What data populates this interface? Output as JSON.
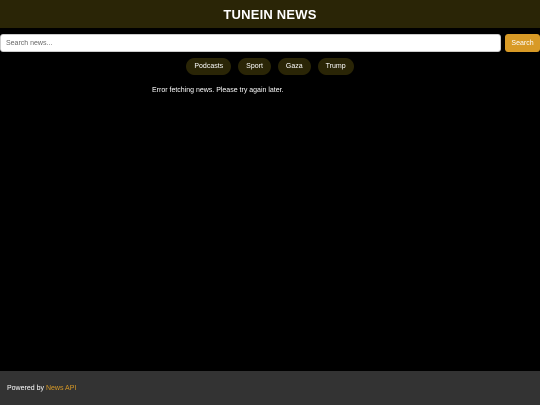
{
  "header": {
    "title": "TUNEIN NEWS"
  },
  "search": {
    "placeholder": "Search news...",
    "value": "",
    "button_label": "Search"
  },
  "categories": [
    {
      "label": "Podcasts"
    },
    {
      "label": "Sport"
    },
    {
      "label": "Gaza"
    },
    {
      "label": "Trump"
    }
  ],
  "content": {
    "error_message": "Error fetching news. Please try again later."
  },
  "footer": {
    "prefix": "Powered by",
    "link_label": "News API"
  },
  "colors": {
    "header_bg": "#2a2506",
    "accent": "#d89a26",
    "footer_bg": "#333333",
    "page_bg": "#000000"
  }
}
